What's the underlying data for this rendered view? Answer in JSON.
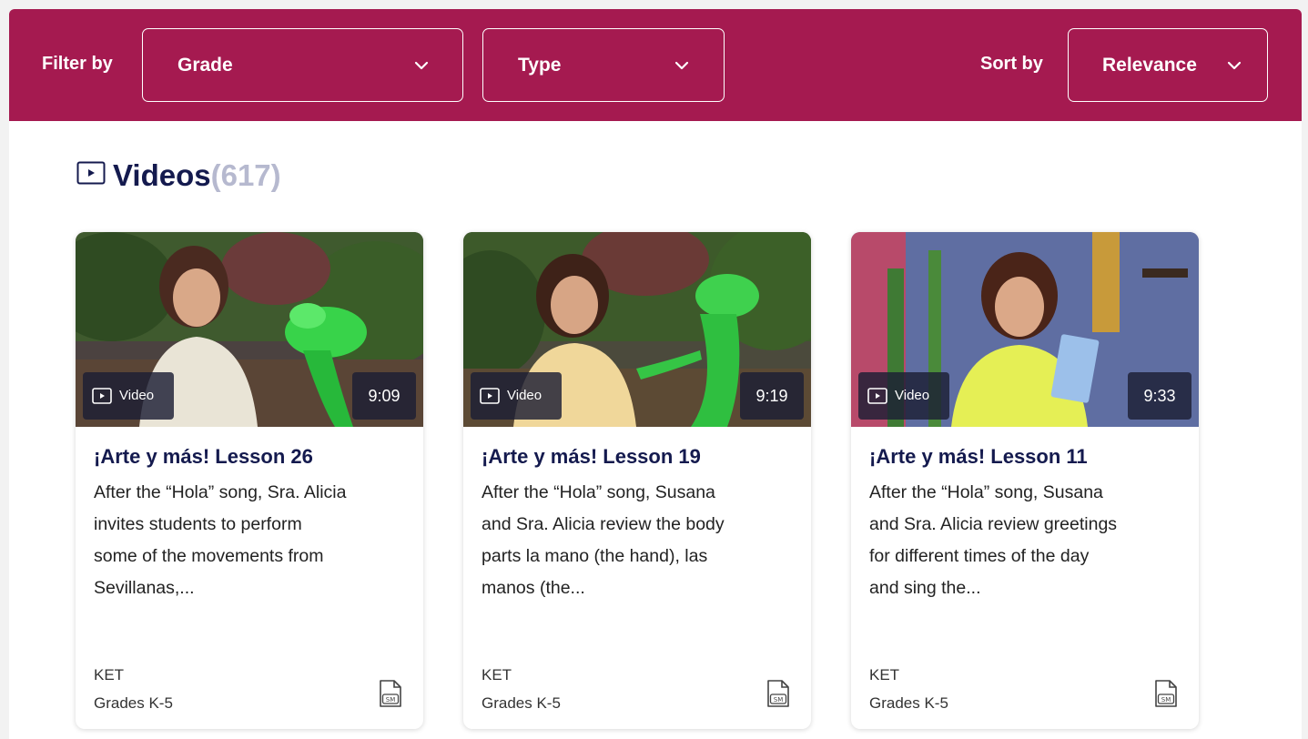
{
  "filters": {
    "filter_label": "Filter by",
    "grade": {
      "value": "Grade"
    },
    "type": {
      "value": "Type"
    },
    "sort_label": "Sort by",
    "sort": {
      "value": "Relevance"
    }
  },
  "section": {
    "icon": "play-box-icon",
    "title": "Videos",
    "count": "(617)"
  },
  "cards": [
    {
      "type_badge": "Video",
      "duration": "9:09",
      "title": "¡Arte y más! Lesson 26",
      "description_lines": [
        "After the “Hola” song, Sra. Alicia",
        "invites students to perform",
        "some of the movements from",
        "Sevillanas,..."
      ],
      "provider": "KET",
      "grades": "Grades K-5",
      "file_icon": "sm-file-icon"
    },
    {
      "type_badge": "Video",
      "duration": "9:19",
      "title": "¡Arte y más! Lesson 19",
      "description_lines": [
        "After the “Hola” song, Susana",
        "and Sra. Alicia review the body",
        "parts la mano (the hand), las",
        "manos (the..."
      ],
      "provider": "KET",
      "grades": "Grades K-5",
      "file_icon": "sm-file-icon"
    },
    {
      "type_badge": "Video",
      "duration": "9:33",
      "title": "¡Arte y más! Lesson 11",
      "description_lines": [
        "After the “Hola” song, Susana",
        "and Sra. Alicia review greetings",
        "for different times of the day",
        "and sing the..."
      ],
      "provider": "KET",
      "grades": "Grades K-5",
      "file_icon": "sm-file-icon"
    }
  ],
  "colors": {
    "bar": "#a51a50",
    "title": "#141a4e",
    "count": "#b6b9cf"
  }
}
